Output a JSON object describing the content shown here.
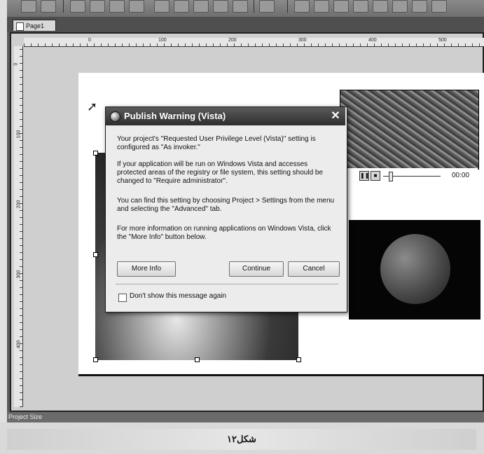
{
  "tab": {
    "label": "Page1"
  },
  "ruler": {
    "top_labels": [
      "0",
      "100",
      "200",
      "300",
      "400",
      "500"
    ],
    "left_labels": [
      "0",
      "100",
      "200",
      "300",
      "400"
    ]
  },
  "dialog": {
    "title": "Publish Warning (Vista)",
    "close_glyph": "✕",
    "paragraphs": [
      "Your project's \"Requested User Privilege Level (Vista)\" setting is configured as \"As invoker.\"",
      "If your application will be run on Windows Vista and accesses protected areas of the registry or file system, this setting should be changed to \"Require administrator\".",
      "You can find this setting by choosing Project > Settings from the menu and selecting the \"Advanced\" tab.",
      "For more information on running applications on Windows Vista, click the \"More Info\" button below."
    ],
    "buttons": {
      "more_info": "More Info",
      "continue": "Continue",
      "cancel": "Cancel"
    },
    "checkbox_label": "Don't show this message again",
    "checkbox_checked": false
  },
  "video": {
    "pause_glyph": "❚❚",
    "stop_glyph": "■",
    "time": "00:00"
  },
  "statusbar": {
    "text": "Project Size"
  },
  "caption": {
    "text": "شکل۱۲"
  },
  "icons": [
    "page-doc-icon",
    "dialog-app-icon",
    "close-icon",
    "cursor-arrow-icon",
    "pause-icon",
    "stop-icon"
  ]
}
